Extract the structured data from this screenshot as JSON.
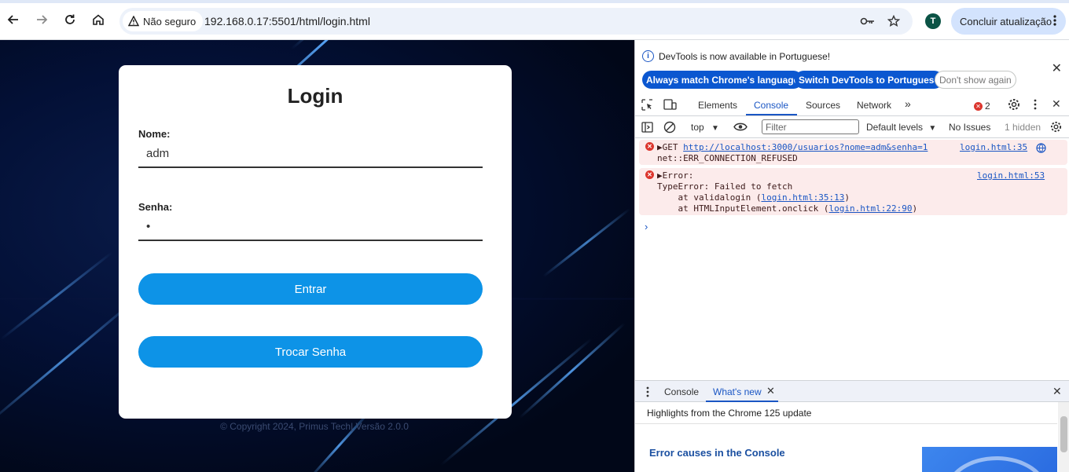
{
  "browser": {
    "security_label": "Não seguro",
    "url": "192.168.0.17:5501/html/login.html",
    "profile_initial": "T",
    "update_label": "Concluir atualização"
  },
  "page": {
    "login_title": "Login",
    "name_label": "Nome:",
    "name_value": "adm",
    "password_label": "Senha:",
    "password_value": "•",
    "enter_button": "Entrar",
    "change_password_button": "Trocar Senha",
    "copyright": "© Copyright 2024, Primus Tech| Versão 2.0.0"
  },
  "devtools": {
    "infobar": {
      "message": "DevTools is now available in Portuguese!",
      "btn_match": "Always match Chrome's language",
      "btn_switch": "Switch DevTools to Portuguese",
      "btn_dont_show": "Don't show again"
    },
    "tabs": [
      "Elements",
      "Console",
      "Sources",
      "Network"
    ],
    "active_tab": "Console",
    "error_count": "2",
    "filterbar": {
      "context": "top",
      "filter_placeholder": "Filter",
      "levels": "Default levels",
      "issues": "No Issues",
      "hidden": "1 hidden"
    },
    "messages": [
      {
        "line1_prefix": "▶GET ",
        "line1_link": "http://localhost:3000/usuarios?nome=adm&senha=1",
        "line2": "net::ERR_CONNECTION_REFUSED",
        "source": "login.html:35"
      },
      {
        "line1": "▶Error:",
        "line2": "TypeError: Failed to fetch",
        "line3_prefix": "    at validalogin (",
        "line3_link": "login.html:35:13",
        "line3_suffix": ")",
        "line4_prefix": "    at HTMLInputElement.onclick (",
        "line4_link": "login.html:22:90",
        "line4_suffix": ")",
        "source": "login.html:53"
      }
    ],
    "drawer": {
      "tab_console": "Console",
      "tab_whatsnew": "What's new",
      "highlights": "Highlights from the Chrome 125 update",
      "feature_title": "Error causes in the Console"
    }
  }
}
